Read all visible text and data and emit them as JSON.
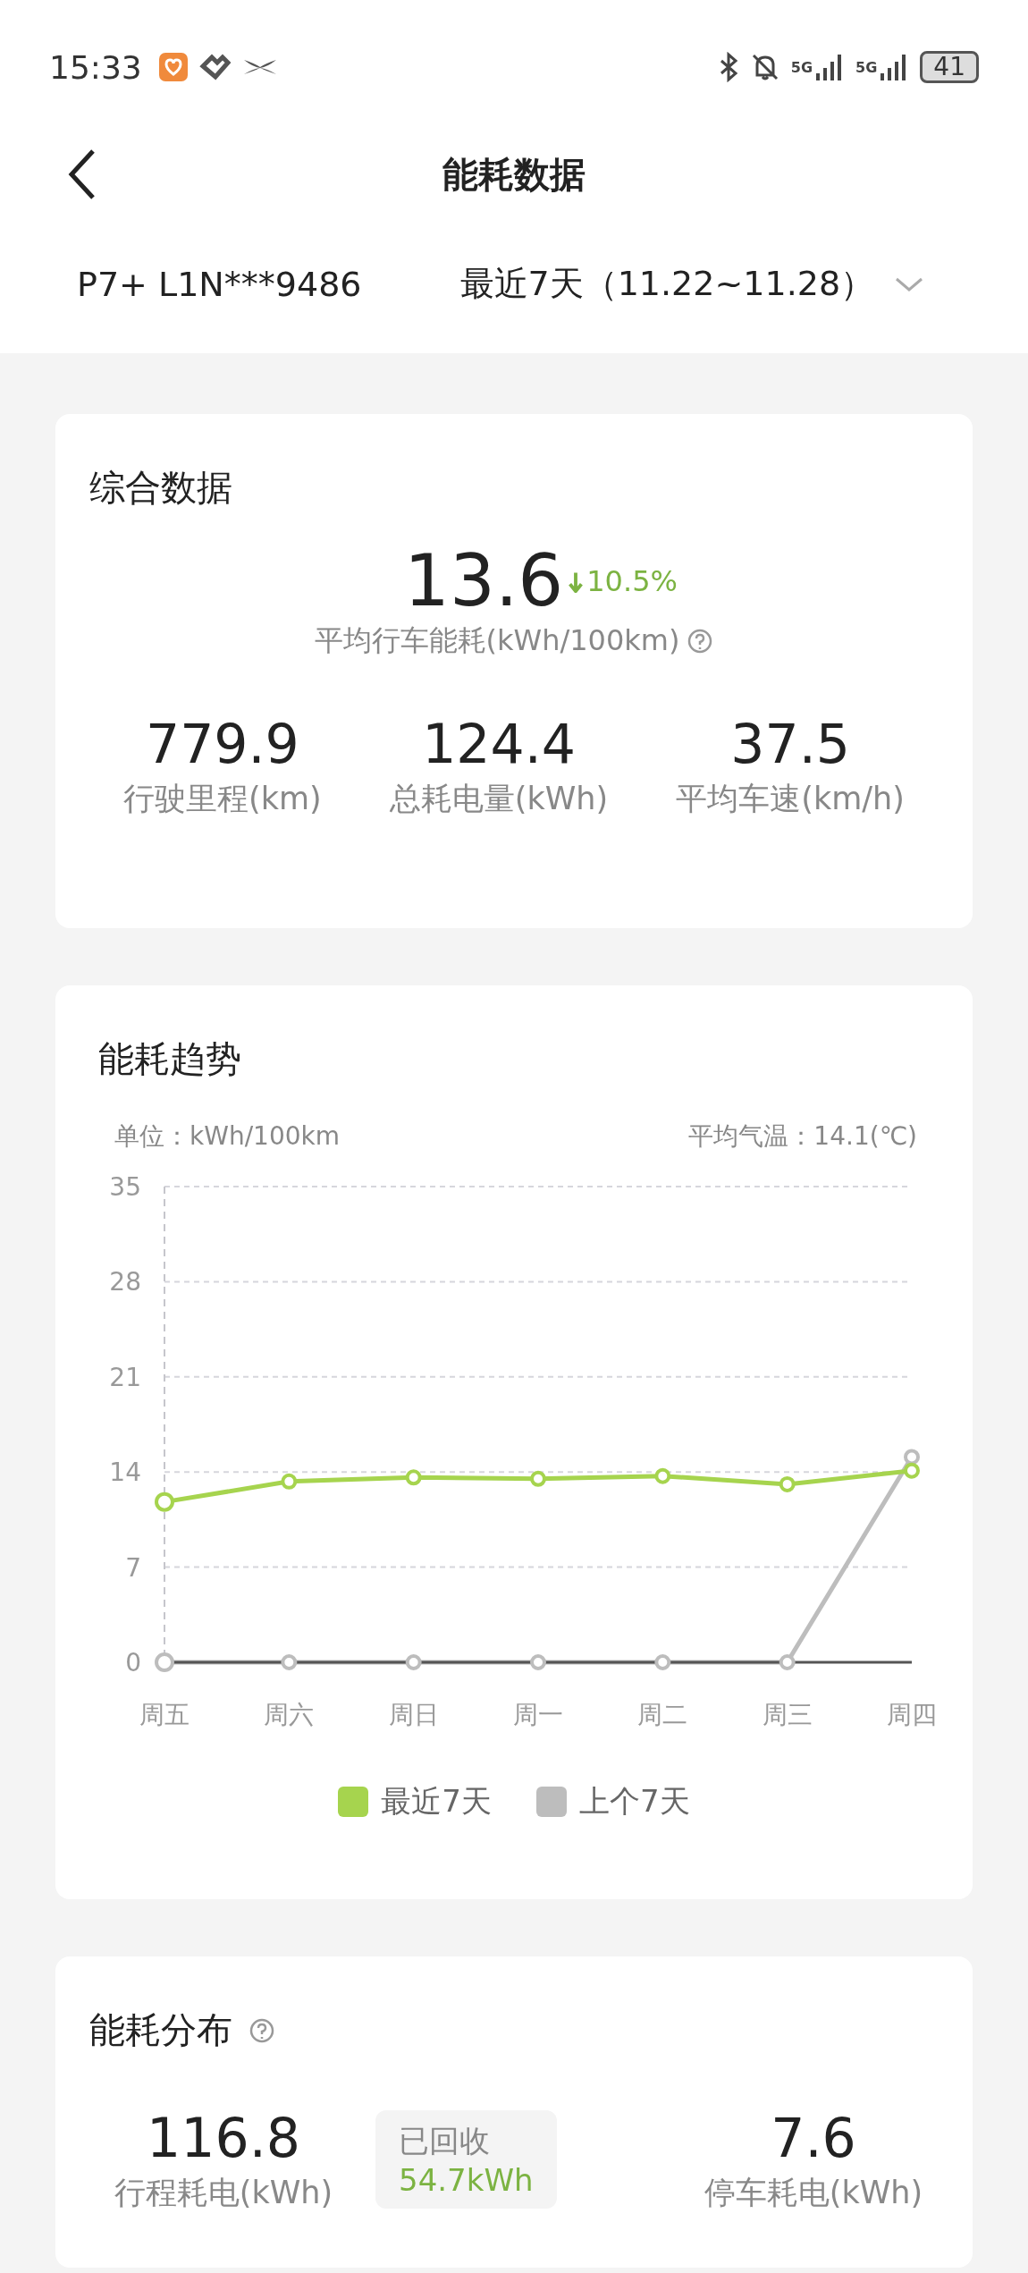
{
  "status_bar": {
    "time": "15:33",
    "network_1": "5G",
    "network_2": "5G",
    "battery": "41"
  },
  "header": {
    "title": "能耗数据"
  },
  "filter": {
    "vehicle": "P7+ L1N***9486",
    "period": "最近7天（11.22~11.28）"
  },
  "summary": {
    "title": "综合数据",
    "value": "13.6",
    "change": {
      "kind": "decrease",
      "text": "10.5%"
    },
    "label": "平均行车能耗(kWh/100km)",
    "stats": [
      {
        "value": "779.9",
        "label": "行驶里程(km)"
      },
      {
        "value": "124.4",
        "label": "总耗电量(kWh)"
      },
      {
        "value": "37.5",
        "label": "平均车速(km/h)"
      }
    ]
  },
  "trend": {
    "title": "能耗趋势",
    "unit": "单位：kWh/100km",
    "temperature": "平均气温：14.1(℃)",
    "chart_data": {
      "type": "line",
      "categories": [
        "周五",
        "周六",
        "周日",
        "周一",
        "周二",
        "周三",
        "周四"
      ],
      "ylim": [
        0,
        35
      ],
      "grid": true,
      "yticks": [
        0,
        7,
        14,
        21,
        28,
        35
      ],
      "series": [
        {
          "name": "最近7天",
          "color": "#a6d44e",
          "marker": true,
          "values": [
            11.8,
            13.3,
            13.6,
            13.5,
            13.7,
            13.1,
            14.1
          ]
        },
        {
          "name": "上个7天",
          "color": "#bdbdbd",
          "marker": true,
          "values": [
            0,
            0,
            0,
            0,
            0,
            0,
            15.1
          ]
        }
      ]
    }
  },
  "distribution": {
    "title": "能耗分布",
    "driving": {
      "value": "116.8",
      "label": "行程耗电(kWh)"
    },
    "recovered": {
      "label": "已回收",
      "value": "54.7kWh"
    },
    "parking": {
      "value": "7.6",
      "label": "停车耗电(kWh)"
    }
  }
}
